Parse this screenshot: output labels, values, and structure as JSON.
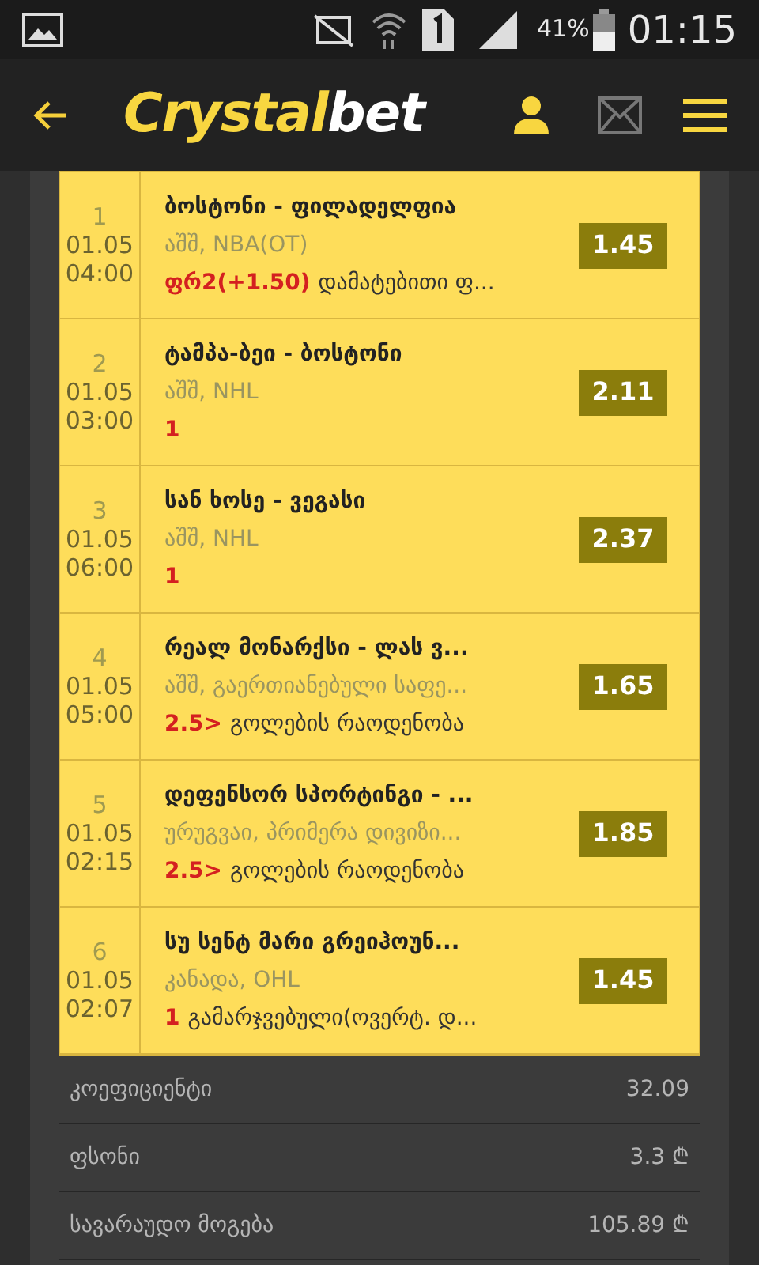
{
  "status_bar": {
    "battery_text": "41%",
    "time": "01:15"
  },
  "header": {
    "logo_primary": "Crystal",
    "logo_secondary": "bet"
  },
  "bets": [
    {
      "index": "1",
      "date": "01.05",
      "time": "04:00",
      "match": "ბოსტონი - ფილადელფია",
      "league": "აშშ, NBA(OT)",
      "pick": "ფრ2(+1.50)",
      "market": "დამატებითი ფ...",
      "odds": "1.45"
    },
    {
      "index": "2",
      "date": "01.05",
      "time": "03:00",
      "match": "ტამპა-ბეი - ბოსტონი",
      "league": "აშშ, NHL",
      "pick": "1",
      "odds": "2.11"
    },
    {
      "index": "3",
      "date": "01.05",
      "time": "06:00",
      "match": "სან ხოსე - ვეგასი",
      "league": "აშშ, NHL",
      "pick": "1",
      "odds": "2.37"
    },
    {
      "index": "4",
      "date": "01.05",
      "time": "05:00",
      "match": "რეალ მონარქსი - ლას ვ...",
      "league": "აშშ, გაერთიანებული საფე...",
      "pick": "2.5>",
      "market": "გოლების რაოდენობა",
      "odds": "1.65"
    },
    {
      "index": "5",
      "date": "01.05",
      "time": "02:15",
      "match": "დეფენსორ სპორტინგი - ...",
      "league": "ურუგვაი, პრიმერა დივიზი...",
      "pick": "2.5>",
      "market": "გოლების რაოდენობა",
      "odds": "1.85"
    },
    {
      "index": "6",
      "date": "01.05",
      "time": "02:07",
      "match": "სუ სენტ მარი გრეიჰოუნ...",
      "league": "კანადა, OHL",
      "pick": "1",
      "market": "გამარჯვებული(ოვერტ. დ...",
      "odds": "1.45"
    }
  ],
  "summary": [
    {
      "label": "კოეფიციენტი",
      "value": "32.09"
    },
    {
      "label": "ფსონი",
      "value": "3.3 ₾"
    },
    {
      "label": "სავარაუდო მოგება",
      "value": "105.89 ₾"
    }
  ]
}
